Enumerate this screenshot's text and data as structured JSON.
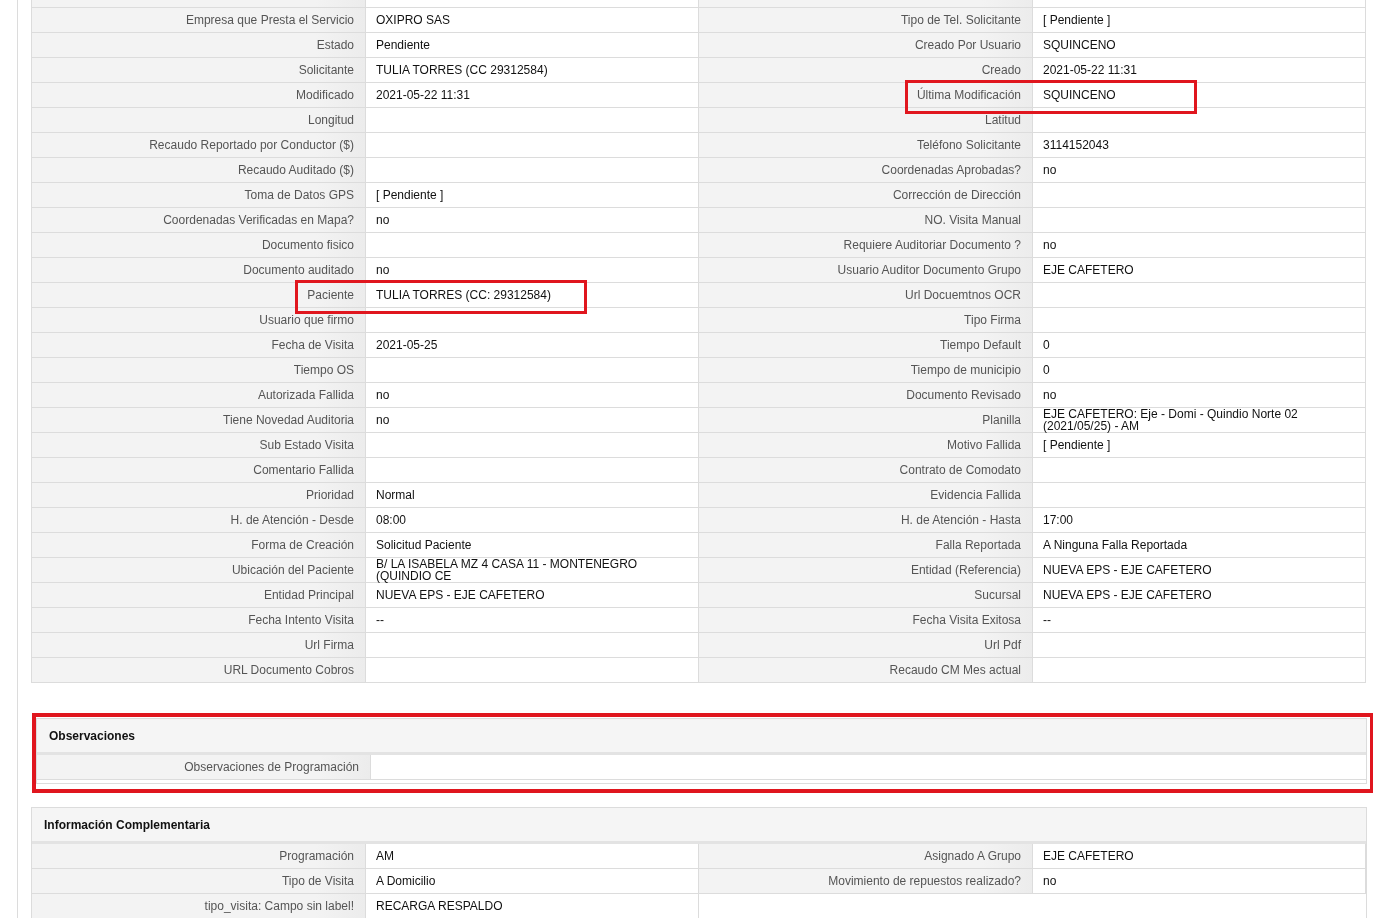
{
  "main_rows": [
    [
      {
        "label": "Empresa que Presta el Servicio",
        "value": "OXIPRO SAS"
      },
      {
        "label": "Tipo de Tel. Solicitante",
        "value": "[ Pendiente ]"
      }
    ],
    [
      {
        "label": "Estado",
        "value": "Pendiente"
      },
      {
        "label": "Creado Por Usuario",
        "value": "SQUINCENO"
      }
    ],
    [
      {
        "label": "Solicitante",
        "value": "TULIA TORRES (CC 29312584)"
      },
      {
        "label": "Creado",
        "value": "2021-05-22 11:31"
      }
    ],
    [
      {
        "label": "Modificado",
        "value": "2021-05-22 11:31"
      },
      {
        "label": "Última Modificación",
        "value": "SQUINCENO",
        "highlighted": true
      }
    ],
    [
      {
        "label": "Longitud"
      },
      {
        "label": "Latitud"
      }
    ],
    [
      {
        "label": "Recaudo Reportado por Conductor ($)"
      },
      {
        "label": "Teléfono Solicitante",
        "value": "3114152043"
      }
    ],
    [
      {
        "label": "Recaudo Auditado ($)"
      },
      {
        "label": "Coordenadas Aprobadas?",
        "value": "no"
      }
    ],
    [
      {
        "label": "Toma de Datos GPS",
        "value": "[ Pendiente ]"
      },
      {
        "label": "Corrección de Dirección"
      }
    ],
    [
      {
        "label": "Coordenadas Verificadas en Mapa?",
        "value": "no"
      },
      {
        "label": "NO. Visita Manual"
      }
    ],
    [
      {
        "label": "Documento fisico"
      },
      {
        "label": "Requiere Auditoriar Documento ?",
        "value": "no"
      }
    ],
    [
      {
        "label": "Documento auditado",
        "value": "no"
      },
      {
        "label": "Usuario Auditor Documento Grupo",
        "value": "EJE CAFETERO"
      }
    ],
    [
      {
        "label": "Paciente",
        "value": "TULIA TORRES (CC: 29312584)",
        "highlighted": true
      },
      {
        "label": "Url Docuemtnos OCR"
      }
    ],
    [
      {
        "label": "Usuario que firmo"
      },
      {
        "label": "Tipo Firma"
      }
    ],
    [
      {
        "label": "Fecha de Visita",
        "value": "2021-05-25"
      },
      {
        "label": "Tiempo Default",
        "value": "0"
      }
    ],
    [
      {
        "label": "Tiempo OS"
      },
      {
        "label": "Tiempo de municipio",
        "value": "0"
      }
    ],
    [
      {
        "label": "Autorizada Fallida",
        "value": "no"
      },
      {
        "label": "Documento Revisado",
        "value": "no"
      }
    ],
    [
      {
        "label": "Tiene Novedad Auditoria",
        "value": "no"
      },
      {
        "label": "Planilla",
        "value": "EJE CAFETERO: Eje - Domi - Quindio Norte 02 (2021/05/25) - AM"
      }
    ],
    [
      {
        "label": "Sub Estado Visita"
      },
      {
        "label": "Motivo Fallida",
        "value": "[ Pendiente ]"
      }
    ],
    [
      {
        "label": "Comentario Fallida"
      },
      {
        "label": "Contrato de Comodato"
      }
    ],
    [
      {
        "label": "Prioridad",
        "value": "Normal"
      },
      {
        "label": "Evidencia Fallida"
      }
    ],
    [
      {
        "label": "H. de Atención - Desde",
        "value": "08:00"
      },
      {
        "label": "H. de Atención - Hasta",
        "value": "17:00"
      }
    ],
    [
      {
        "label": "Forma de Creación",
        "value": "Solicitud Paciente"
      },
      {
        "label": "Falla Reportada",
        "value": "A Ninguna Falla Reportada"
      }
    ],
    [
      {
        "label": "Ubicación del Paciente",
        "value": "B/ LA ISABELA MZ 4 CASA 11 - MONTENEGRO (QUINDIO CE"
      },
      {
        "label": "Entidad (Referencia)",
        "value": "NUEVA EPS - EJE CAFETERO"
      }
    ],
    [
      {
        "label": "Entidad Principal",
        "value": "NUEVA EPS - EJE CAFETERO"
      },
      {
        "label": "Sucursal",
        "value": "NUEVA EPS - EJE CAFETERO"
      }
    ],
    [
      {
        "label": "Fecha Intento Visita",
        "value": "--"
      },
      {
        "label": "Fecha Visita Exitosa",
        "value": "--"
      }
    ],
    [
      {
        "label": "Url Firma"
      },
      {
        "label": "Url Pdf"
      }
    ],
    [
      {
        "label": "URL Documento Cobros"
      },
      {
        "label": "Recaudo CM Mes actual"
      }
    ]
  ],
  "sections": [
    {
      "title": "Observaciones",
      "highlighted": true,
      "kind": "wide",
      "rows": [
        [
          {
            "label": "Observaciones de Programación"
          }
        ]
      ]
    },
    {
      "title": "Información Complementaria",
      "kind": "pairs",
      "rows": [
        [
          {
            "label": "Programación",
            "value": "AM"
          },
          {
            "label": "Asignado A Grupo",
            "value": "EJE CAFETERO"
          }
        ],
        [
          {
            "label": "Tipo de Visita",
            "value": "A Domicilio"
          },
          {
            "label": "Movimiento de repuestos realizado?",
            "value": "no"
          }
        ],
        [
          {
            "label": "tipo_visita: Campo sin label!",
            "value": "RECARGA RESPALDO"
          }
        ]
      ]
    }
  ]
}
